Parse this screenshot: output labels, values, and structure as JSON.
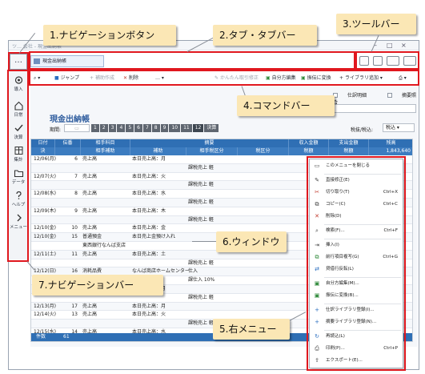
{
  "window": {
    "title": "ツ… 会社 - 現金出納帳"
  },
  "nav_button": {
    "label": "…"
  },
  "tab": {
    "label": "現金出納帳"
  },
  "sidebar": {
    "items": [
      {
        "label": "導入",
        "icon": "gear-icon"
      },
      {
        "label": "日常",
        "icon": "home-icon"
      },
      {
        "label": "決算",
        "icon": "check-icon"
      },
      {
        "label": "集計",
        "icon": "table-icon"
      },
      {
        "label": "データ",
        "icon": "folder-icon"
      },
      {
        "label": "ヘルプ",
        "icon": "help-icon"
      },
      {
        "label": "メニュー",
        "icon": "chevron-right-icon"
      }
    ]
  },
  "commands": {
    "jump": "ジャンプ",
    "supplement": "補助作成",
    "delete": "削除",
    "more": "…",
    "simple_fix": "かんたん取引修正",
    "self_edit": "自分方編集",
    "tax_convert": "振伝に変換",
    "library_add": "ライブラリ追加"
  },
  "page": {
    "title": "現金出納帳",
    "period_label": "期間:",
    "months": [
      "1",
      "2",
      "3",
      "4",
      "5",
      "6",
      "7",
      "8",
      "9",
      "10",
      "11",
      "12",
      "決算"
    ],
    "check_a": "仕訳明細",
    "check_b": "摘要照合",
    "search_placeholder": "検索文字",
    "tax_label": "税抜/税込:",
    "tax_value": "税込"
  },
  "grid": {
    "headers_top": [
      "日付",
      "伝番",
      "相手科目",
      "摘要",
      "収入金額",
      "支出金額",
      "残高"
    ],
    "headers_sub": [
      "決",
      "",
      "相手補助",
      "補助",
      "相手税区分",
      "税区分",
      "税額",
      "税額",
      "1,843,640"
    ],
    "rows": [
      [
        "12/06(月)",
        "6",
        "売上高",
        "本日売上高：月",
        ""
      ],
      [
        "",
        "",
        "",
        "",
        "課税売上 軽"
      ],
      [
        "12/07(火)",
        "7",
        "売上高",
        "本日売上高：火",
        ""
      ],
      [
        "",
        "",
        "",
        "",
        "課税売上 軽"
      ],
      [
        "12/08(水)",
        "8",
        "売上高",
        "本日売上高：水",
        ""
      ],
      [
        "",
        "",
        "",
        "",
        "課税売上 軽"
      ],
      [
        "12/09(木)",
        "9",
        "売上高",
        "本日売上高：木",
        ""
      ],
      [
        "",
        "",
        "",
        "",
        "課税売上 軽"
      ],
      [
        "12/10(金)",
        "10",
        "売上高",
        "本日売上高：金",
        ""
      ],
      [
        "12/10(金)",
        "15",
        "普通預金",
        "本日売上金預け入れ",
        ""
      ],
      [
        "",
        "",
        "東西銀行なんば支店",
        "",
        ""
      ],
      [
        "12/11(土)",
        "11",
        "売上高",
        "本日売上高：土",
        ""
      ],
      [
        "",
        "",
        "",
        "",
        "課税売上 軽"
      ],
      [
        "12/12(日)",
        "16",
        "消耗品費",
        "なんば商店ホームセンター",
        "仕入"
      ],
      [
        "",
        "",
        "",
        "",
        "課仕入 10%"
      ],
      [
        "12/13(月)",
        "12",
        "売上高",
        "本日売上高：月",
        ""
      ],
      [
        "",
        "",
        "",
        "",
        "課税売上 軽"
      ],
      [
        "12/13(月)",
        "17",
        "売上高",
        "本日売上高：月",
        ""
      ],
      [
        "12/14(火)",
        "13",
        "売上高",
        "本日売上高：火",
        ""
      ],
      [
        "",
        "",
        "",
        "",
        "課税売上 軽"
      ],
      [
        "12/15(水)",
        "14",
        "売上高",
        "本日売上高：水",
        ""
      ]
    ],
    "footer_left": "件数",
    "footer_count": "61"
  },
  "context_menu": {
    "items": [
      {
        "label": "このメニューを閉じる",
        "shortcut": "",
        "icon": "close-icon"
      },
      {
        "label": "直接修正(E)",
        "shortcut": "",
        "icon": "pencil-icon"
      },
      {
        "label": "切り取り(T)",
        "shortcut": "Ctrl+X",
        "icon": "scissors-icon"
      },
      {
        "label": "コピー(C)",
        "shortcut": "Ctrl+C",
        "icon": "copy-icon"
      },
      {
        "label": "削除(D)",
        "shortcut": "",
        "icon": "delete-icon"
      },
      {
        "label": "検索(F)...",
        "shortcut": "Ctrl+F",
        "icon": "search-icon"
      },
      {
        "label": "挿入(I)",
        "shortcut": "",
        "icon": "insert-icon"
      },
      {
        "label": "前行項目複写(G)",
        "shortcut": "Ctrl+G",
        "icon": "copy-row-icon"
      },
      {
        "label": "貸借行反転(L)",
        "shortcut": "",
        "icon": "swap-icon"
      },
      {
        "label": "自分方編集(M)...",
        "shortcut": "",
        "icon": "edit-icon"
      },
      {
        "label": "振伝に変換(B)...",
        "shortcut": "",
        "icon": "convert-icon"
      },
      {
        "label": "仕訳ライブラリ登録(I)...",
        "shortcut": "",
        "icon": "plus-icon"
      },
      {
        "label": "摘要ライブラリ登録(N)...",
        "shortcut": "",
        "icon": "plus-icon"
      },
      {
        "label": "再読込(L)",
        "shortcut": "",
        "icon": "refresh-icon"
      },
      {
        "label": "印刷(P)...",
        "shortcut": "Ctrl+P",
        "icon": "print-icon"
      },
      {
        "label": "エクスポート(E)...",
        "shortcut": "",
        "icon": "export-icon"
      }
    ]
  },
  "callouts": {
    "c1": "1.ナビゲーションボタン",
    "c2": "2.タブ・タブバー",
    "c3": "3.ツールバー",
    "c4": "4.コマンドバー",
    "c5": "5.右メニュー",
    "c6": "6.ウィンドウ",
    "c7": "7.ナビゲーションバー"
  },
  "colors": {
    "accent_red": "#e0171e",
    "callout_bg": "#fbe7b5",
    "grid_header": "#2f6fb4",
    "title_blue": "#2f5d9e"
  }
}
